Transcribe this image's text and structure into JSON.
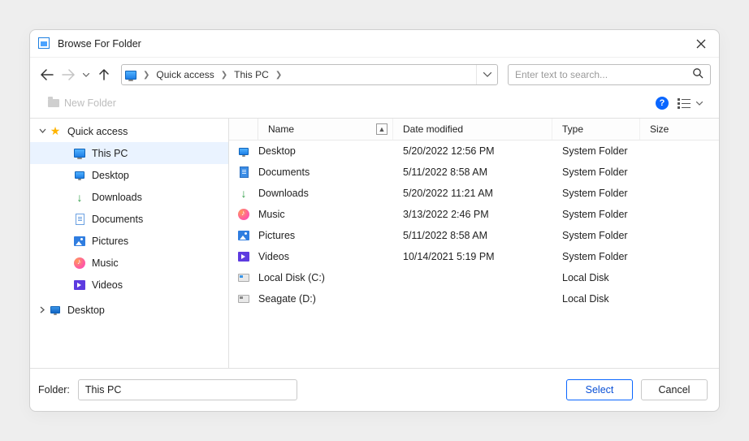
{
  "window": {
    "title": "Browse For Folder"
  },
  "nav": {
    "back_enabled": true,
    "forward_enabled": false
  },
  "breadcrumbs": [
    "Quick access",
    "This PC"
  ],
  "search": {
    "placeholder": "Enter text to search..."
  },
  "toolbar": {
    "new_folder_label": "New Folder",
    "help_glyph": "?"
  },
  "tree": {
    "root": {
      "label": "Quick access",
      "expanded": true,
      "children": [
        {
          "id": "thispc",
          "label": "This PC",
          "icon": "monitor",
          "selected": true
        },
        {
          "id": "desktop",
          "label": "Desktop",
          "icon": "monitor-sm"
        },
        {
          "id": "downloads",
          "label": "Downloads",
          "icon": "download"
        },
        {
          "id": "documents",
          "label": "Documents",
          "icon": "doc"
        },
        {
          "id": "pictures",
          "label": "Pictures",
          "icon": "pic"
        },
        {
          "id": "music",
          "label": "Music",
          "icon": "music"
        },
        {
          "id": "videos",
          "label": "Videos",
          "icon": "video"
        }
      ]
    },
    "second": {
      "label": "Desktop",
      "expanded": false,
      "icon": "monitor-dark"
    }
  },
  "list": {
    "columns": {
      "name": "Name",
      "date": "Date modified",
      "type": "Type",
      "size": "Size"
    },
    "rows": [
      {
        "icon": "monitor-sm",
        "name": "Desktop",
        "date": "5/20/2022 12:56 PM",
        "type": "System Folder",
        "size": ""
      },
      {
        "icon": "doc-blue",
        "name": "Documents",
        "date": "5/11/2022 8:58 AM",
        "type": "System Folder",
        "size": ""
      },
      {
        "icon": "download",
        "name": "Downloads",
        "date": "5/20/2022 11:21 AM",
        "type": "System Folder",
        "size": ""
      },
      {
        "icon": "music",
        "name": "Music",
        "date": "3/13/2022 2:46 PM",
        "type": "System Folder",
        "size": ""
      },
      {
        "icon": "pic",
        "name": "Pictures",
        "date": "5/11/2022 8:58 AM",
        "type": "System Folder",
        "size": ""
      },
      {
        "icon": "video",
        "name": "Videos",
        "date": "10/14/2021 5:19 PM",
        "type": "System Folder",
        "size": ""
      },
      {
        "icon": "disk",
        "name": "Local Disk (C:)",
        "date": "",
        "type": "Local Disk",
        "size": ""
      },
      {
        "icon": "disk-ext",
        "name": "Seagate (D:)",
        "date": "",
        "type": "Local Disk",
        "size": ""
      }
    ]
  },
  "footer": {
    "label": "Folder:",
    "value": "This PC",
    "select_label": "Select",
    "cancel_label": "Cancel"
  }
}
